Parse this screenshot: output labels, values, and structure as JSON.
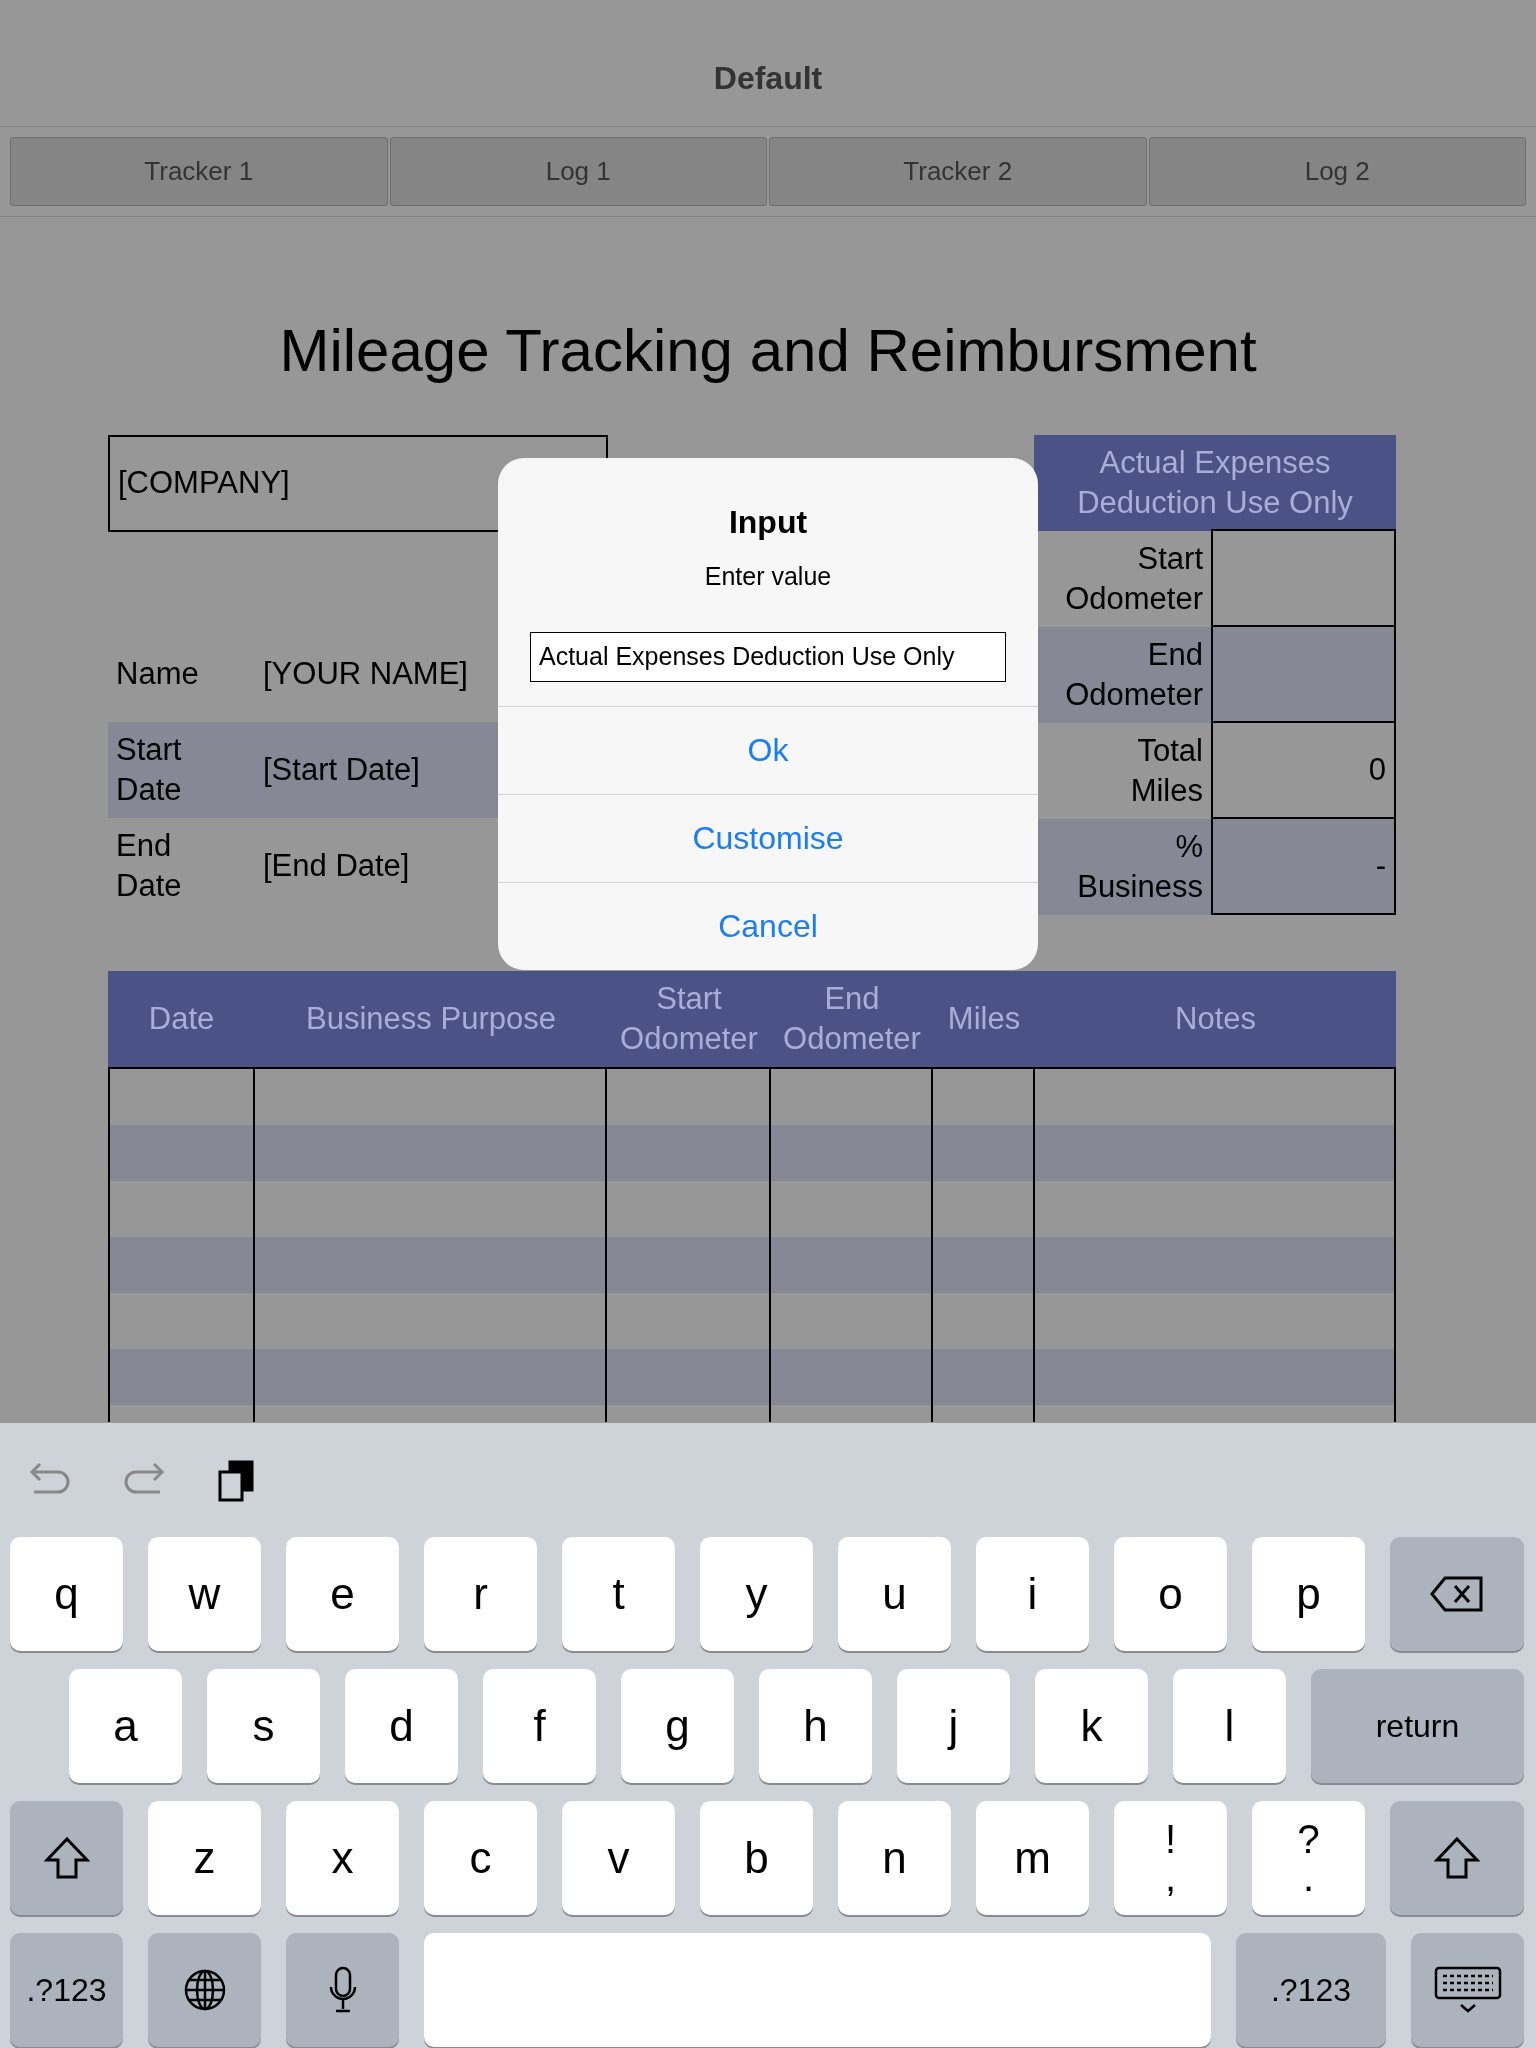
{
  "nav_title": "Default",
  "tabs": [
    {
      "label": "Tracker 1"
    },
    {
      "label": "Log 1"
    },
    {
      "label": "Tracker 2"
    },
    {
      "label": "Log 2"
    }
  ],
  "heading": "Mileage Tracking and Reimbursment",
  "company": "[COMPANY]",
  "info_rows": [
    {
      "label": "Name",
      "value": "[YOUR NAME]",
      "shaded": false
    },
    {
      "label": "Start Date",
      "value": "[Start Date]",
      "shaded": true
    },
    {
      "label": "End Date",
      "value": "[End Date]",
      "shaded": false
    }
  ],
  "expenses_panel": {
    "title": "Actual Expenses Deduction Use Only",
    "rows": [
      {
        "label": "Start Odometer",
        "shaded": false
      },
      {
        "label": "End Odometer",
        "shaded": true
      },
      {
        "label": "Total Miles",
        "value": "0",
        "shaded": false
      },
      {
        "label": "% Business",
        "value": "-",
        "shaded": true
      }
    ]
  },
  "log_table": {
    "columns": [
      "Date",
      "Business Purpose",
      "Start Odometer",
      "End Odometer",
      "Miles",
      "Notes"
    ]
  },
  "dialog": {
    "title": "Input",
    "message": "Enter value",
    "input_value": "Actual Expenses Deduction Use Only",
    "buttons": [
      "Ok",
      "Customise",
      "Cancel"
    ]
  },
  "keyboard": {
    "key_rows": [
      {
        "keys": [
          {
            "kind": "letter",
            "label": "q"
          },
          {
            "kind": "letter",
            "label": "w"
          },
          {
            "kind": "letter",
            "label": "e"
          },
          {
            "kind": "letter",
            "label": "r"
          },
          {
            "kind": "letter",
            "label": "t"
          },
          {
            "kind": "letter",
            "label": "y"
          },
          {
            "kind": "letter",
            "label": "u"
          },
          {
            "kind": "letter",
            "label": "i"
          },
          {
            "kind": "letter",
            "label": "o"
          },
          {
            "kind": "letter",
            "label": "p"
          },
          {
            "kind": "backspace"
          }
        ]
      },
      {
        "keys": [
          {
            "kind": "letter",
            "label": "a"
          },
          {
            "kind": "letter",
            "label": "s"
          },
          {
            "kind": "letter",
            "label": "d"
          },
          {
            "kind": "letter",
            "label": "f"
          },
          {
            "kind": "letter",
            "label": "g"
          },
          {
            "kind": "letter",
            "label": "h"
          },
          {
            "kind": "letter",
            "label": "j"
          },
          {
            "kind": "letter",
            "label": "k"
          },
          {
            "kind": "letter",
            "label": "l"
          },
          {
            "kind": "return",
            "label": "return"
          }
        ]
      },
      {
        "keys": [
          {
            "kind": "shift"
          },
          {
            "kind": "letter",
            "label": "z"
          },
          {
            "kind": "letter",
            "label": "x"
          },
          {
            "kind": "letter",
            "label": "c"
          },
          {
            "kind": "letter",
            "label": "v"
          },
          {
            "kind": "letter",
            "label": "b"
          },
          {
            "kind": "letter",
            "label": "n"
          },
          {
            "kind": "letter",
            "label": "m"
          },
          {
            "kind": "dual",
            "label": "!",
            "sublabel": ","
          },
          {
            "kind": "dual",
            "label": "?",
            "sublabel": "."
          },
          {
            "kind": "shift"
          }
        ]
      },
      {
        "keys": [
          {
            "kind": "mode",
            "label": ".?123"
          },
          {
            "kind": "globe"
          },
          {
            "kind": "mic"
          },
          {
            "kind": "space"
          },
          {
            "kind": "mode",
            "label": ".?123"
          },
          {
            "kind": "hide"
          }
        ]
      }
    ]
  }
}
